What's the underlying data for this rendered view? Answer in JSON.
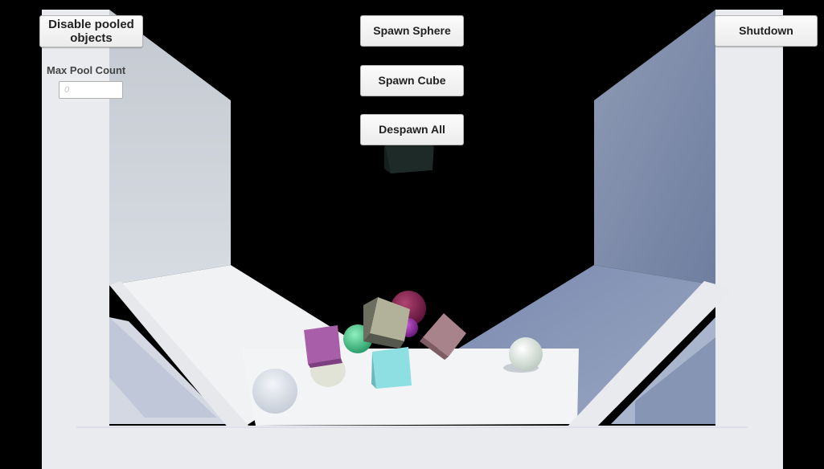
{
  "controls": {
    "disable_pooled_label": "Disable pooled objects",
    "max_pool_count_label": "Max Pool Count",
    "max_pool_count_placeholder": "0",
    "spawn_sphere_label": "Spawn Sphere",
    "spawn_cube_label": "Spawn Cube",
    "despawn_all_label": "Despawn All",
    "shutdown_label": "Shutdown"
  },
  "colors": {
    "background": "#000000",
    "arena": "#e9ebef",
    "sphere_magenta": "#8a1f55",
    "sphere_purple": "#9a2fae",
    "sphere_green": "#47c98f",
    "sphere_white": "#e3ece5",
    "sphere_glass": "#d3d9e2",
    "cube_olive": "#a8a98a",
    "cube_magenta": "#a35aa6",
    "cube_rose": "#a68088",
    "cube_cyan": "#89dde0",
    "cube_dark": "#1f2b29"
  },
  "scene_objects": [
    "sphere",
    "sphere",
    "sphere",
    "sphere",
    "sphere",
    "cube",
    "cube",
    "cube",
    "cube",
    "cube"
  ]
}
